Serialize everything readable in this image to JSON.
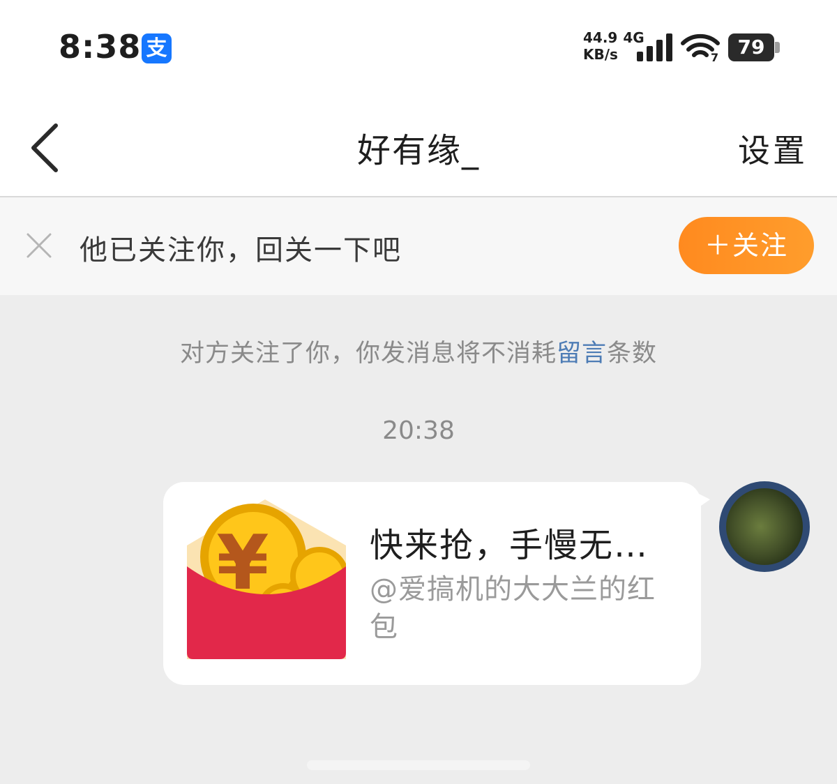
{
  "status_bar": {
    "time": "8:38",
    "app_icon": "alipay-icon",
    "app_icon_glyph": "支",
    "net_speed": "44.9",
    "net_unit": "KB/s",
    "net_type": "4G",
    "wifi_badge": "7",
    "battery": "79"
  },
  "nav": {
    "title": "好有缘_",
    "settings_label": "设置"
  },
  "follow_bar": {
    "text": "他已关注你，回关一下吧",
    "button_label": "＋关注",
    "accent": "#ff9424"
  },
  "chat": {
    "notice_prefix": "对方关注了你，你发消息将不消耗",
    "notice_link": "留言",
    "notice_suffix": "条数",
    "timestamp": "20:38",
    "red_packet": {
      "title": "快来抢，手慢无…",
      "subtitle": "@爱搞机的大大兰的红包",
      "icon": "red-envelope-icon",
      "currency_glyph": "¥",
      "color": "#e2284a"
    }
  }
}
